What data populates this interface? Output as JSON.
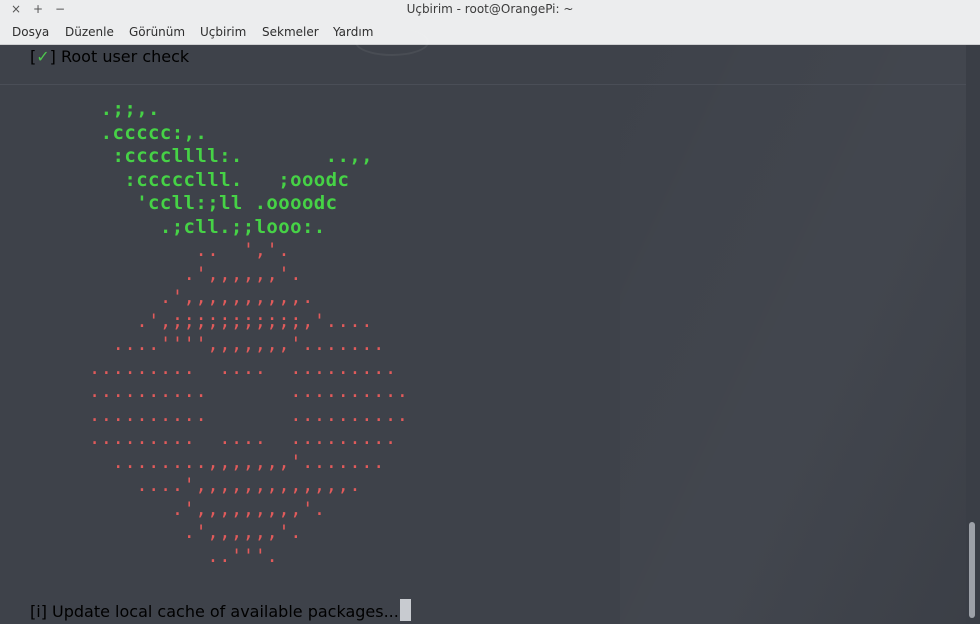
{
  "window": {
    "title": "Uçbirim - root@OrangePi: ~",
    "controls": {
      "close": "×",
      "maximize": "+",
      "minimize": "−"
    }
  },
  "menu": [
    "Dosya",
    "Düzenle",
    "Görünüm",
    "Uçbirim",
    "Sekmeler",
    "Yardım"
  ],
  "terminal": {
    "root_check": {
      "open": "[",
      "mark": "✓",
      "close": "]",
      "text": " Root user check"
    },
    "logo_green": [
      ".;;,.",
      ".ccccc:,.",
      " :ccccllll:.       ..,,",
      "  :ccccclll.   ;ooodc",
      "   'ccll:;ll .oooodc",
      "     .;cll.;;looo:."
    ],
    "logo_red": [
      "          ..  ','.",
      "         .',,,,,,'.",
      "       .',,,,,,,,,,.",
      "     .',;;;;;;;;;;;,'....",
      "   ....'''',,,,,,,'.......",
      " .........  ....  .........",
      " ..........       ..........",
      " ..........       ..........",
      " .........  ....  .........",
      "   ........,,,,,,,'.......",
      "     ....',,,,,,,,,,,,,.",
      "        .',,,,,,,,,'.",
      "         .',,,,,,'.",
      "           ..'''."
    ],
    "update_line": "[i] Update local cache of available packages..."
  }
}
